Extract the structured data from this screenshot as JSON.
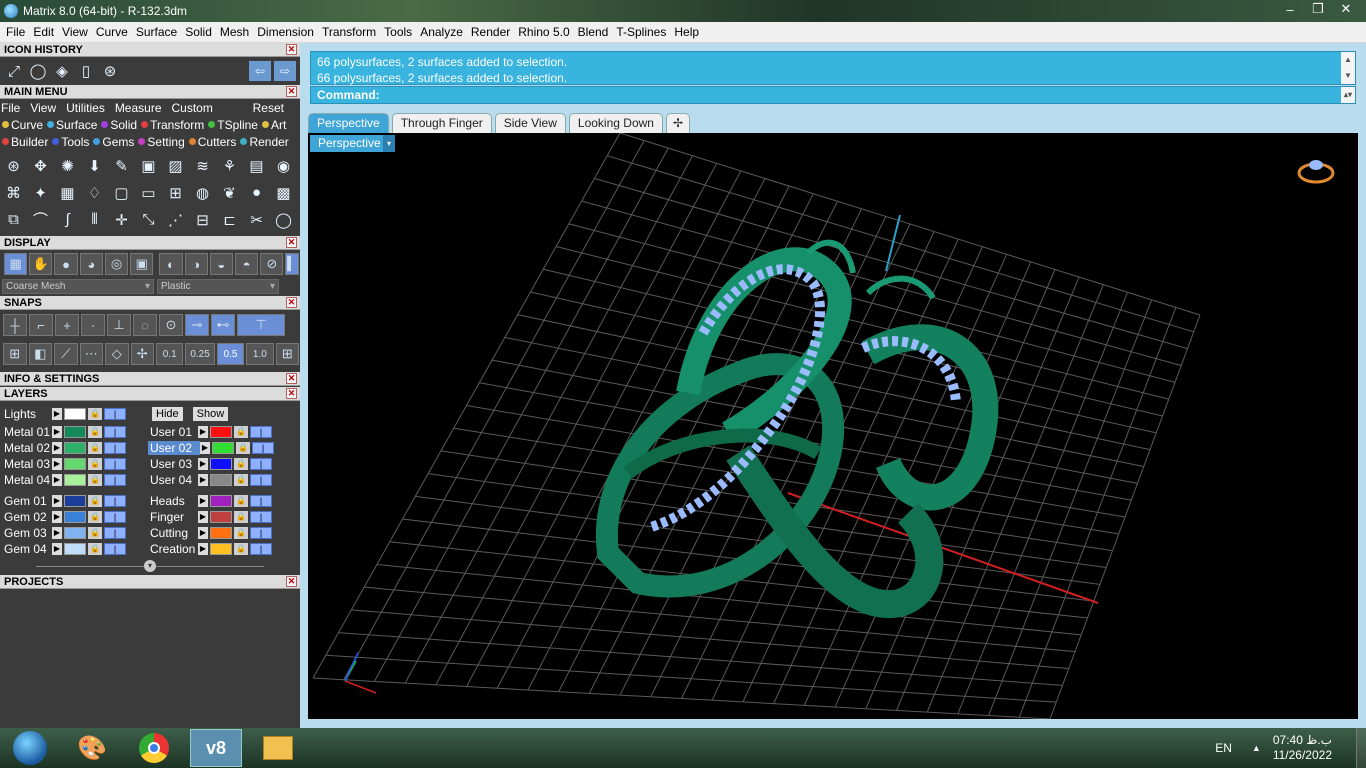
{
  "window": {
    "title": "Matrix 8.0 (64-bit) - R-132.3dm",
    "btn_min": "‒",
    "btn_max": "❐",
    "btn_close": "✕"
  },
  "menubar": [
    "File",
    "Edit",
    "View",
    "Curve",
    "Surface",
    "Solid",
    "Mesh",
    "Dimension",
    "Transform",
    "Tools",
    "Analyze",
    "Render",
    "Rhino 5.0",
    "Blend",
    "T-Splines",
    "Help"
  ],
  "icon_history": {
    "title": "ICON HISTORY",
    "close": "✕",
    "back": "⇦",
    "forward": "⇨"
  },
  "main_menu": {
    "title": "MAIN MENU",
    "close": "✕",
    "items": [
      "File",
      "View",
      "Utilities",
      "Measure",
      "Custom"
    ],
    "reset": "Reset",
    "categories_row1": [
      {
        "label": "Curve",
        "color": "#e0c040"
      },
      {
        "label": "Surface",
        "color": "#40b0e0"
      },
      {
        "label": "Solid",
        "color": "#a040e0"
      },
      {
        "label": "Transform",
        "color": "#e04040"
      },
      {
        "label": "TSpline",
        "color": "#40c040"
      },
      {
        "label": "Art",
        "color": "#e0c040"
      }
    ],
    "categories_row2": [
      {
        "label": "Builder",
        "color": "#e04040"
      },
      {
        "label": "Tools",
        "color": "#4060e0"
      },
      {
        "label": "Gems",
        "color": "#40a0e0"
      },
      {
        "label": "Setting",
        "color": "#c040c0"
      },
      {
        "label": "Cutters",
        "color": "#e08030"
      },
      {
        "label": "Render",
        "color": "#40b0c0"
      }
    ]
  },
  "display": {
    "title": "DISPLAY",
    "close": "✕",
    "mesh": "Coarse Mesh",
    "material": "Plastic"
  },
  "snaps": {
    "title": "SNAPS",
    "close": "✕",
    "values": [
      "0.1",
      "0.25",
      "0.5",
      "1.0"
    ]
  },
  "info": {
    "title": "INFO & SETTINGS",
    "close": "✕"
  },
  "layers": {
    "title": "LAYERS",
    "close": "✕",
    "lights": "Lights",
    "hide": "Hide",
    "show": "Show",
    "left": [
      {
        "name": "Metal 01",
        "color": "#128a5a"
      },
      {
        "name": "Metal 02",
        "color": "#2eb06a"
      },
      {
        "name": "Metal 03",
        "color": "#66d870"
      },
      {
        "name": "Metal 04",
        "color": "#a8f09a"
      },
      {
        "name": "Gem 01",
        "color": "#1a3e9a"
      },
      {
        "name": "Gem 02",
        "color": "#3a7fd8"
      },
      {
        "name": "Gem 03",
        "color": "#7fb4f0"
      },
      {
        "name": "Gem 04",
        "color": "#c0dcf8"
      }
    ],
    "right": [
      {
        "name": "User 01",
        "color": "#ff1010"
      },
      {
        "name": "User 02",
        "color": "#30e030"
      },
      {
        "name": "User 03",
        "color": "#1010ff"
      },
      {
        "name": "User 04",
        "color": "#888888"
      },
      {
        "name": "Heads",
        "color": "#a020c0"
      },
      {
        "name": "Finger",
        "color": "#c04040"
      },
      {
        "name": "Cutting",
        "color": "#ff7010"
      },
      {
        "name": "Creation",
        "color": "#ffc020"
      }
    ]
  },
  "projects": {
    "title": "PROJECTS",
    "close": "✕"
  },
  "history": [
    "66 polysurfaces, 2 surfaces added to selection.",
    "66 polysurfaces, 2 surfaces added to selection."
  ],
  "command_label": "Command:",
  "tabs": [
    "Perspective",
    "Through Finger",
    "Side View",
    "Looking Down"
  ],
  "tab_add": "✢",
  "viewport": {
    "label": "Perspective",
    "dropdown": "▾"
  },
  "taskbar": {
    "lang": "EN",
    "time": "07:40 ب.ظ",
    "date": "11/26/2022"
  }
}
